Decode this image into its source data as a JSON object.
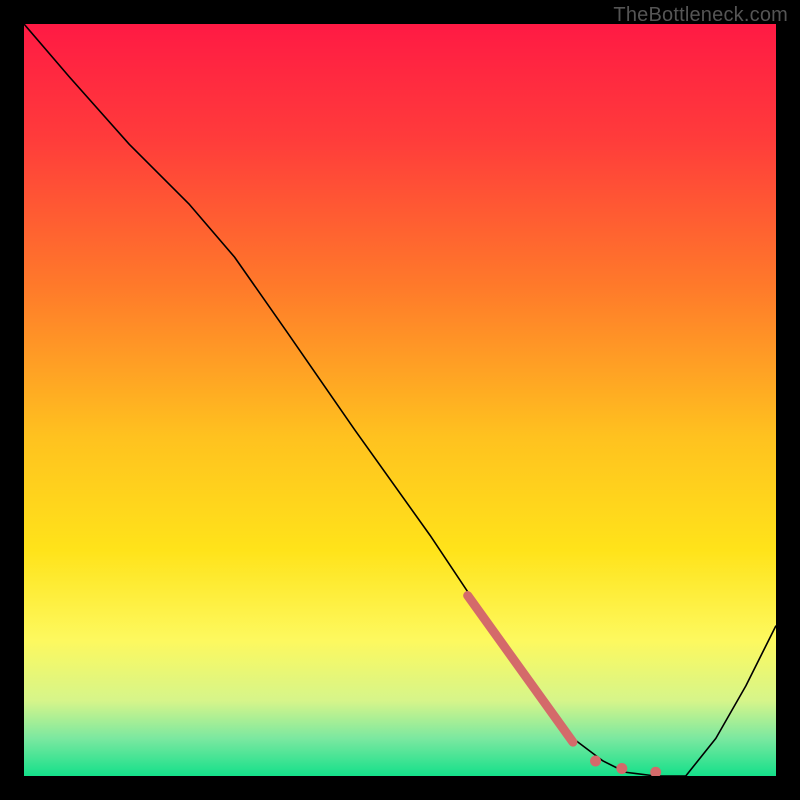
{
  "watermark": "TheBottleneck.com",
  "chart_data": {
    "type": "line",
    "title": "",
    "xlabel": "",
    "ylabel": "",
    "xlim": [
      0,
      100
    ],
    "ylim": [
      0,
      100
    ],
    "grid": false,
    "legend": false,
    "gradient_stops": [
      {
        "offset": 0.0,
        "color": "#ff1a44"
      },
      {
        "offset": 0.15,
        "color": "#ff3b3b"
      },
      {
        "offset": 0.35,
        "color": "#ff7a2a"
      },
      {
        "offset": 0.55,
        "color": "#ffc21f"
      },
      {
        "offset": 0.7,
        "color": "#ffe31a"
      },
      {
        "offset": 0.82,
        "color": "#fdf95f"
      },
      {
        "offset": 0.9,
        "color": "#d6f58a"
      },
      {
        "offset": 0.95,
        "color": "#7be8a0"
      },
      {
        "offset": 1.0,
        "color": "#14e08a"
      }
    ],
    "series": [
      {
        "name": "bottleneck-curve",
        "stroke": "#000000",
        "stroke_width": 1.6,
        "x": [
          0.0,
          6.0,
          14.0,
          22.0,
          28.0,
          35.0,
          44.0,
          54.0,
          62.0,
          68.0,
          73.0,
          77.0,
          80.0,
          84.0,
          88.0,
          92.0,
          96.0,
          100.0
        ],
        "y": [
          100.0,
          93.0,
          84.0,
          76.0,
          69.0,
          59.0,
          46.0,
          32.0,
          20.0,
          11.0,
          5.0,
          2.0,
          0.5,
          0.0,
          0.0,
          5.0,
          12.0,
          20.0
        ]
      }
    ],
    "marker_band": {
      "name": "highlight-band",
      "color": "#d46a6a",
      "stroke_width": 9,
      "cap": "round",
      "x": [
        59.0,
        73.0
      ],
      "y": [
        24.0,
        4.5
      ]
    },
    "marker_dots": {
      "name": "highlight-dots",
      "color": "#d46a6a",
      "r": 5.5,
      "points": [
        {
          "x": 76.0,
          "y": 2.0
        },
        {
          "x": 79.5,
          "y": 1.0
        },
        {
          "x": 84.0,
          "y": 0.5
        }
      ]
    }
  }
}
